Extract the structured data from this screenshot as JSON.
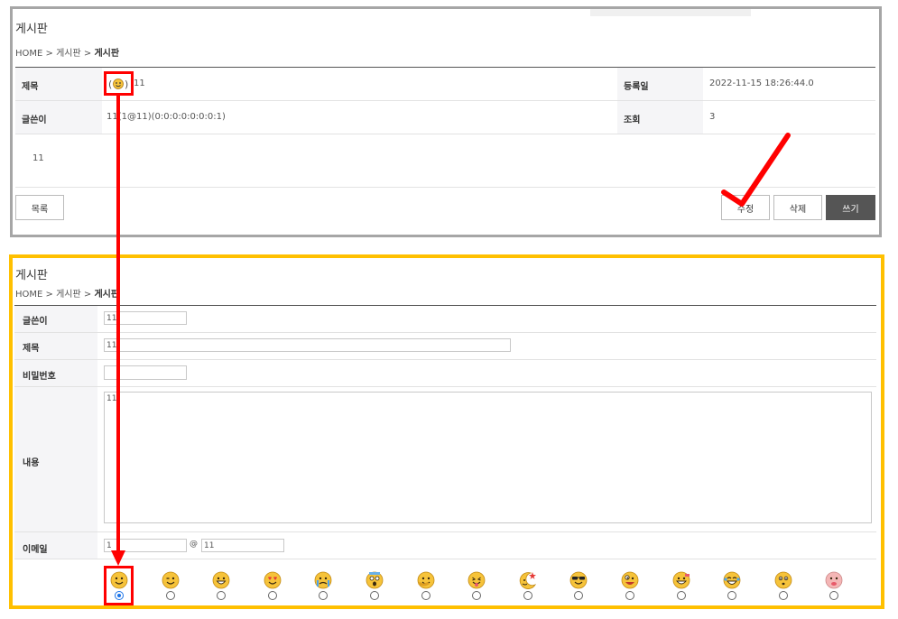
{
  "view": {
    "title": "게시판",
    "breadcrumb": {
      "home": "HOME",
      "sep1": ">",
      "board": "게시판",
      "sep2": ">",
      "current": "게시판"
    },
    "rows": {
      "subject_label": "제목",
      "subject_value": "11",
      "date_label": "등록일",
      "date_value": "2022-11-15 18:26:44.0",
      "author_label": "글쓴이",
      "author_value": "11(1@11)(0:0:0:0:0:0:0:1)",
      "views_label": "조회",
      "views_value": "3"
    },
    "content": "11",
    "buttons": {
      "list": "목록",
      "edit": "수정",
      "delete": "삭제",
      "write": "쓰기"
    }
  },
  "form": {
    "title": "게시판",
    "breadcrumb": {
      "home": "HOME",
      "sep1": ">",
      "board": "게시판",
      "sep2": ">",
      "current": "게시판"
    },
    "labels": {
      "author": "글쓴이",
      "subject": "제목",
      "password": "비밀번호",
      "content": "내용",
      "email": "이메일"
    },
    "values": {
      "author": "11",
      "subject": "11",
      "password": "",
      "content": "11",
      "email_user": "1",
      "email_at": "@",
      "email_domain": "11"
    },
    "emoticons": [
      "smile",
      "wink",
      "grin",
      "heart-eyes",
      "crying",
      "shocked",
      "hand-face",
      "tongue",
      "star-moon",
      "sunglasses",
      "goofy",
      "silly",
      "laugh-tears",
      "pout",
      "blush"
    ],
    "selected_emoticon_index": 0
  },
  "colors": {
    "top_border": "#a6a6a6",
    "bottom_border": "#ffc000",
    "annotation_red": "#ff0000",
    "write_button": "#555555"
  }
}
